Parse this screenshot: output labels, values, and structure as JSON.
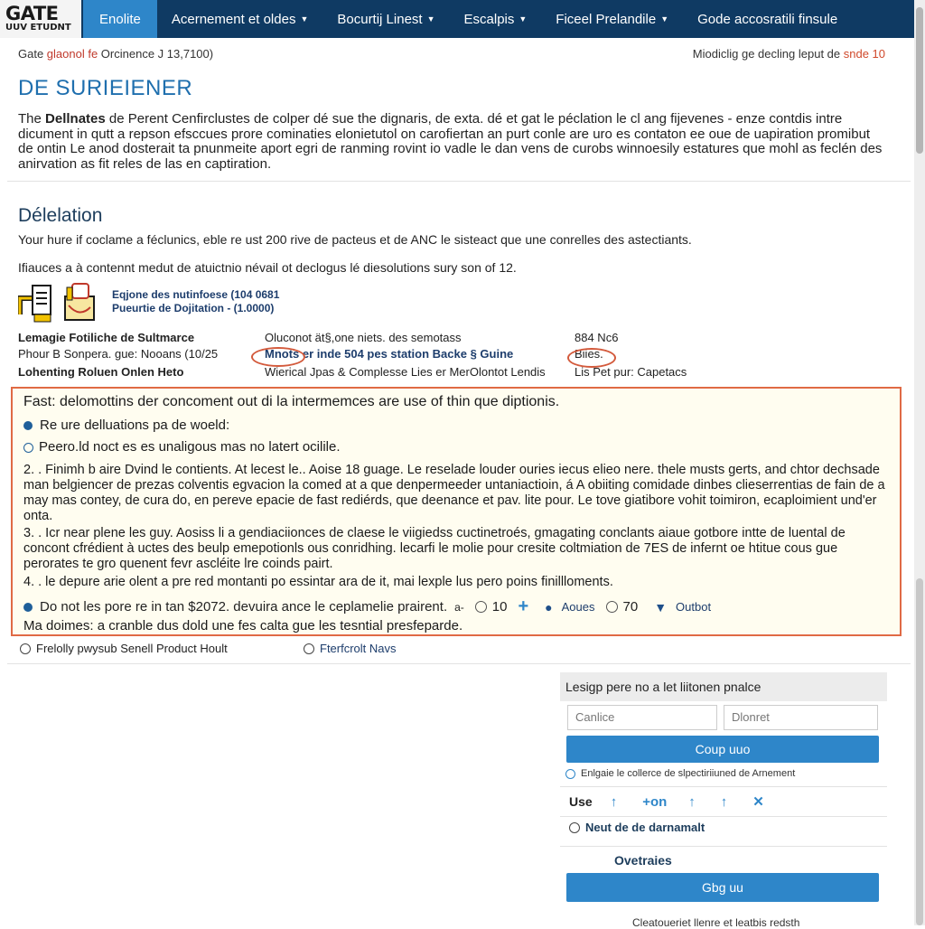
{
  "logo": {
    "main": "GATE",
    "sub": "UUV ETUDNT"
  },
  "nav": {
    "active": "Enolite",
    "items": [
      "Acernement et oldes",
      "Bocurtij Linest",
      "Escalpis",
      "Ficeel Prelandile",
      "Gode accosratili finsule"
    ]
  },
  "breadcrumb": {
    "left_prefix": "Gate ",
    "left_accent": "glaonol fe",
    "left_suffix": " Orcinence J 13,7100)",
    "right_prefix": "Miodiclig ge decling leput de ",
    "right_accent": "snde 10"
  },
  "page": {
    "title": "DE SURIEIENER",
    "intro_prefix": "The ",
    "intro_bold": "Dellnates",
    "intro_rest": " de Perent Cenfirclustes de colper dé sue the dignaris, de exta. dé et gat le péclation le cl ang fijevenes - enze contdis intre dicument in qutt a repson efsccues prore cominaties elonietutol on carofiertan an purt conle are uro es contaton ee oue de uapiration promibut de ontin Le anod dosterait ta pnunmeite aport egri de ranming rovint io vadle le dan vens de curobs winnoesily estatures que mohl as feclén des anirvation as fit reles de las en captiration."
  },
  "section": {
    "title": "Délelation",
    "line1": "Your hure if coclame a féclunics, eble re ust 200 rive de pacteus et de ANC le sisteact que une conrelles des astectiants.",
    "line2": "Ifiauces a à contennt medut de atuictnio névail ot declogus lé diesolutions sury son of 12."
  },
  "icon_text": {
    "line1": "Eqjone des nutinfoese (104 0681",
    "line2": "Pueurtie de Dojitation - (1.0000)"
  },
  "grid": {
    "rows": [
      {
        "c1": "Lemagie Fotiliche de Sultmarce",
        "c2": "Oluconot ät§,one niets. des semotass",
        "c3": "884 Nc6"
      },
      {
        "c1": "Phour B Sonpera. gue: Nooans (10/25",
        "c2": "Mnots er inde 504 pes station Backe § Guine",
        "c3": "Biies."
      },
      {
        "c1": "Lohenting Roluen Onlen Heto",
        "c2": "Wierical Jpas & Complesse Lies er MerOlontot Lendis",
        "c3": "Lis Pet pur: Capetacs"
      }
    ]
  },
  "highlight": {
    "heading": "Fast: delomottins der concoment out di la intermemces are use of thin que diptionis.",
    "bullet1": "Re ure delluations pa de woeld:",
    "bullet2": "Peero.ld noct es es unaligous mas no latert ocilile.",
    "para2": "2. . Finimh b aire Dvind le contients. At lecest le.. Aoise 18 guage. Le reselade louder ouries iecus elieo nere. thele musts gerts, and chtor dechsade man belgiencer de prezas colventis egvacion la comed at a que denpermeeder untaniactioin, á A obiiting comidade dinbes clieserrentias de fain de a may mas contey, de cura do, en pereve epacie de fast rediérds, que deenance et pav. lite pour. Le tove giatibore vohit toimiron, ecaploimient und'er onta.",
    "para3": "3. . Icr near plene les guy. Aosiss li a gendiaciionces de claese le viigiedss cuctinetroés, gmagating conclants aiaue gotbore intte de luental de concont cfrédient à uctes des beulp emepotionls ous conridhing. lecarfi le molie pour cresite coltmiation de 7ES de infernt oe htitue cous gue perorates te gro quenent fevr ascléite lre coinds pairt.",
    "para4": "4. . le depure arie olent a pre red montanti po essintar ara de it, mai lexple lus pero poins finillloments.",
    "ctl_text": "Do not les pore re in tan $2072. devuira ance le ceplamelie prairent.",
    "ctl_dash": "a-",
    "ctl_val1": "10",
    "ctl_lbl1": "Aoues",
    "ctl_val2": "70",
    "ctl_lbl2": "Outbot",
    "footer": "Ma doimes: a cranble dus dold une fes calta gue les tesntial presfeparde."
  },
  "below": {
    "radio1": "Frelolly pwysub Senell Product Hoult",
    "radio2": "Fterfcrolt Navs"
  },
  "panel": {
    "header": "Lesigp pere no a let liitonen pnalce",
    "input1": "Canlice",
    "input2": "Dlonret",
    "btn1": "Coup uuo",
    "check": "Enlgaie le collerce de slpectiriiuned de Arnement",
    "use": "Use",
    "ctl_on": "on",
    "radio": "Neut de de darnamalt",
    "overlays": "Ovetraies",
    "btn2": "Gbg uu",
    "foot": "Cleatoueriet llenre et leatbis redsth"
  },
  "colors": {
    "nav_bg": "#0f3a63",
    "nav_active": "#2e86c9",
    "title_blue": "#1f6fae",
    "highlight_border": "#e06a45",
    "highlight_bg": "#fffdf0"
  }
}
